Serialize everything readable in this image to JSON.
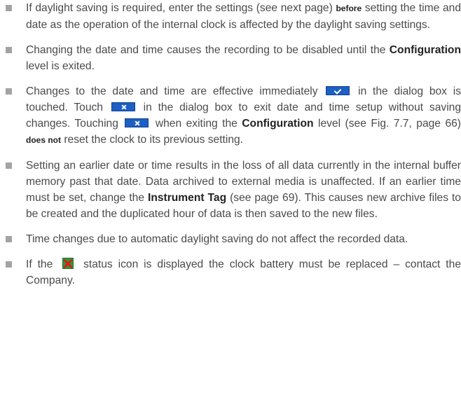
{
  "items": [
    {
      "id": "daylight",
      "t1": "If daylight saving is required, enter the settings (see next page) ",
      "t2": "before",
      "t3": " setting the time and date as the operation of the internal clock is affected by the daylight saving settings."
    },
    {
      "id": "recording",
      "t1": "Changing the date and time causes the recording to be disabled until the ",
      "t2": "Configuration",
      "t3": " level is exited."
    },
    {
      "id": "effective",
      "t1": "Changes to the date and time are effective immediately ",
      "t2": " in the dialog box is touched. Touch ",
      "t3": " in the dialog box to exit date and time setup without saving changes. Touching ",
      "t4": " when exiting the ",
      "t5": "Configuration",
      "t6": " level (see Fig. 7.7, page 66) ",
      "t7": "does not",
      "t8": " reset the clock to its previous setting."
    },
    {
      "id": "earlier",
      "t1": "Setting an earlier date or time results in the loss of all data currently in the internal buffer memory past that date. Data archived to external media is unaffected. If an earlier time must be set, change the ",
      "t2": "Instrument Tag",
      "t3": " (see page 69). This causes new archive files to be created and the duplicated hour of data is then saved to the new files."
    },
    {
      "id": "auto",
      "t1": "Time changes due to automatic daylight saving do not affect the recorded data."
    },
    {
      "id": "battery",
      "t1": "If the ",
      "t2": " status icon is displayed the clock battery must be replaced – contact the Company."
    }
  ],
  "icons": {
    "ok_button": "checkmark-button-icon",
    "cancel_button": "cross-button-icon",
    "battery_status": "clock-battery-status-icon"
  },
  "colors": {
    "text": "#4a4a4a",
    "bold_text": "#222222",
    "bullet": "#a3a3a3",
    "button_blue": "#1d5fc4",
    "battery_icon_green": "#2a9c3b",
    "battery_icon_red": "#e01b1b"
  }
}
